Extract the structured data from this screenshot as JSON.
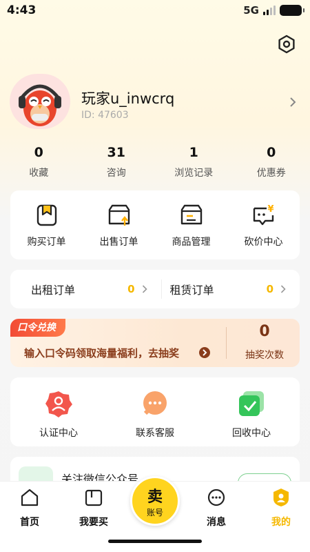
{
  "status_bar": {
    "time": "4:43",
    "network": "5G"
  },
  "profile": {
    "username": "玩家u_inwcrq",
    "user_id": "ID: 47603"
  },
  "stats": [
    {
      "value": "0",
      "label": "收藏"
    },
    {
      "value": "31",
      "label": "咨询"
    },
    {
      "value": "1",
      "label": "浏览记录"
    },
    {
      "value": "0",
      "label": "优惠券"
    }
  ],
  "orders": [
    {
      "label": "购买订单",
      "icon": "bookmark-box-icon"
    },
    {
      "label": "出售订单",
      "icon": "box-upload-icon"
    },
    {
      "label": "商品管理",
      "icon": "box-list-icon"
    },
    {
      "label": "砍价中心",
      "icon": "yen-chat-icon"
    }
  ],
  "rent": {
    "out_label": "出租订单",
    "out_count": "0",
    "in_label": "租赁订单",
    "in_count": "0"
  },
  "promo": {
    "tag": "口令兑换",
    "text": "输入口令码领取海量福利，去抽奖",
    "count": "0",
    "count_label": "抽奖次数"
  },
  "services": [
    {
      "label": "认证中心",
      "icon": "verify-user-icon"
    },
    {
      "label": "联系客服",
      "icon": "chat-bubble-icon"
    },
    {
      "label": "回收中心",
      "icon": "recycle-check-icon"
    }
  ],
  "wechat": {
    "text": "关注微信公众号"
  },
  "tabbar": {
    "home": "首页",
    "buy": "我要买",
    "sell_big": "卖",
    "sell_small": "账号",
    "messages": "消息",
    "mine": "我的"
  },
  "colors": {
    "accent": "#f5b800",
    "sell_button": "#ffd41f",
    "promo_red": "#f24b35",
    "promo_text": "#8a3d1c"
  }
}
